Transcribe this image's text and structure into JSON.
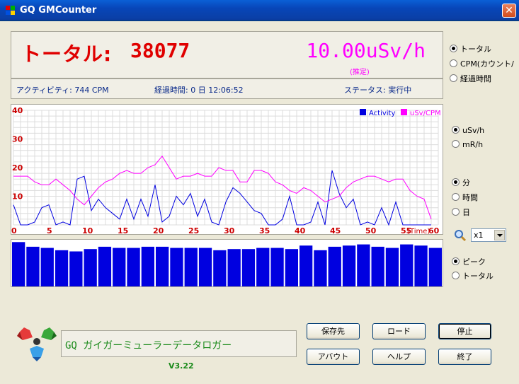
{
  "window": {
    "title": "GQ GMCounter",
    "close_glyph": "✕"
  },
  "counter": {
    "label": "トータル:",
    "value": "38077",
    "dose": "10.00uSv/h",
    "estimate": "(推定)"
  },
  "status": {
    "activity": "アクティビティ: 744 CPM",
    "elapsed": "経過時間: 0 日 12:06:52",
    "state": "ステータス: 実行中"
  },
  "display_mode": {
    "options": [
      "トータル",
      "CPM(カウント/",
      "経過時間"
    ],
    "selected": 0
  },
  "unit": {
    "options": [
      "uSv/h",
      "mR/h"
    ],
    "selected": 0
  },
  "time_scale": {
    "options": [
      "分",
      "時間",
      "日"
    ],
    "selected": 0
  },
  "bar_mode": {
    "options": [
      "ピーク",
      "トータル"
    ],
    "selected": 0
  },
  "zoom": {
    "value": "x1",
    "icon": "magnifier-icon"
  },
  "logger": {
    "text": "GQ ガイガーミューラーデータロガー",
    "version": "V3.22"
  },
  "buttons": {
    "save_to": "保存先",
    "load": "ロード",
    "stop": "停止",
    "about": "アバウト",
    "help": "ヘルプ",
    "exit": "終了"
  },
  "colors": {
    "title_bar": "#0a4fc7",
    "counter_red": "#e00000",
    "dose_magenta": "#ff00ff",
    "activity_blue": "#0000e0",
    "axis_red": "#cc0000"
  },
  "chart_data": {
    "type": "line",
    "xlabel": "(Time)",
    "x_ticks": [
      0,
      5,
      10,
      15,
      20,
      25,
      30,
      35,
      40,
      45,
      50,
      55,
      60
    ],
    "y_ticks": [
      10,
      20,
      30,
      40
    ],
    "xlim": [
      0,
      60
    ],
    "ylim": [
      0,
      40
    ],
    "grid": true,
    "legend": "top-right",
    "x": [
      0,
      1,
      2,
      3,
      4,
      5,
      6,
      7,
      8,
      9,
      10,
      11,
      12,
      13,
      14,
      15,
      16,
      17,
      18,
      19,
      20,
      21,
      22,
      23,
      24,
      25,
      26,
      27,
      28,
      29,
      30,
      31,
      32,
      33,
      34,
      35,
      36,
      37,
      38,
      39,
      40,
      41,
      42,
      43,
      44,
      45,
      46,
      47,
      48,
      49,
      50,
      51,
      52,
      53,
      54,
      55,
      56,
      57,
      58,
      59
    ],
    "series": [
      {
        "name": "Activity",
        "color": "#0000e0",
        "values": [
          7,
          0,
          0,
          1,
          6,
          7,
          0,
          1,
          0,
          16,
          17,
          5,
          9,
          6,
          4,
          2,
          9,
          2,
          9,
          3,
          14,
          1,
          3,
          10,
          7,
          11,
          3,
          9,
          1,
          0,
          8,
          13,
          11,
          8,
          5,
          4,
          0,
          0,
          2,
          10,
          0,
          0,
          1,
          8,
          0,
          19,
          11,
          6,
          9,
          0,
          1,
          0,
          6,
          0,
          8,
          0,
          0,
          0,
          0,
          0
        ]
      },
      {
        "name": "uSv/CPM",
        "color": "#ff00ff",
        "values": [
          17,
          17,
          17,
          15,
          14,
          14,
          16,
          14,
          12,
          9,
          7,
          10,
          13,
          15,
          16,
          18,
          19,
          18,
          18,
          20,
          21,
          24,
          20,
          16,
          17,
          17,
          18,
          17,
          17,
          20,
          19,
          19,
          15,
          15,
          19,
          19,
          18,
          15,
          14,
          12,
          11,
          13,
          12,
          10,
          8,
          9,
          10,
          13,
          15,
          16,
          17,
          17,
          16,
          15,
          16,
          16,
          12,
          10,
          9,
          2
        ]
      }
    ],
    "bars": {
      "count": 30,
      "values": [
        38,
        34,
        33,
        31,
        30,
        32,
        34,
        33,
        33,
        34,
        34,
        33,
        33,
        33,
        31,
        32,
        32,
        33,
        33,
        32,
        35,
        31,
        34,
        35,
        36,
        34,
        33,
        36,
        35,
        33
      ]
    }
  }
}
